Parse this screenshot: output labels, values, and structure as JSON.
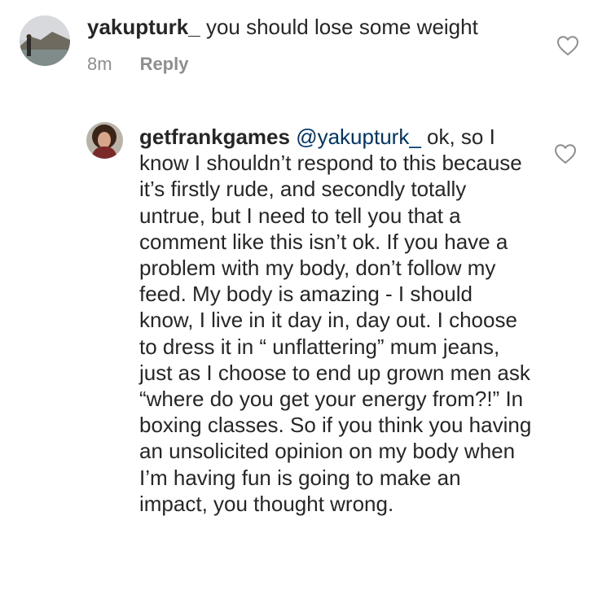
{
  "comments": [
    {
      "username": "yakupturk_",
      "text": " you should lose some weight",
      "time": "8m",
      "reply_label": "Reply"
    },
    {
      "username": "getfrankgames",
      "mention": "@yakupturk_",
      "text": " ok, so I know I shouldn’t respond to this because it’s firstly rude, and secondly totally untrue, but I need to tell you that a comment like this isn’t ok. If you have a problem with my body, don’t follow my feed. My body is amazing - I should know, I live in it day in, day out. I choose to dress it in “ unflattering” mum jeans, just as I choose to end up grown men ask “where do you get your energy from?!” In boxing classes. So if you think you having an unsolicited opinion on my body when I’m having fun is going to make an impact, you thought wrong."
    }
  ],
  "icons": {
    "like": "heart-outline-icon",
    "avatar": "profile-avatar"
  },
  "colors": {
    "text": "#262626",
    "meta": "#8e8e8e",
    "mention": "#003569",
    "heart_stroke": "#8e8e8e"
  }
}
